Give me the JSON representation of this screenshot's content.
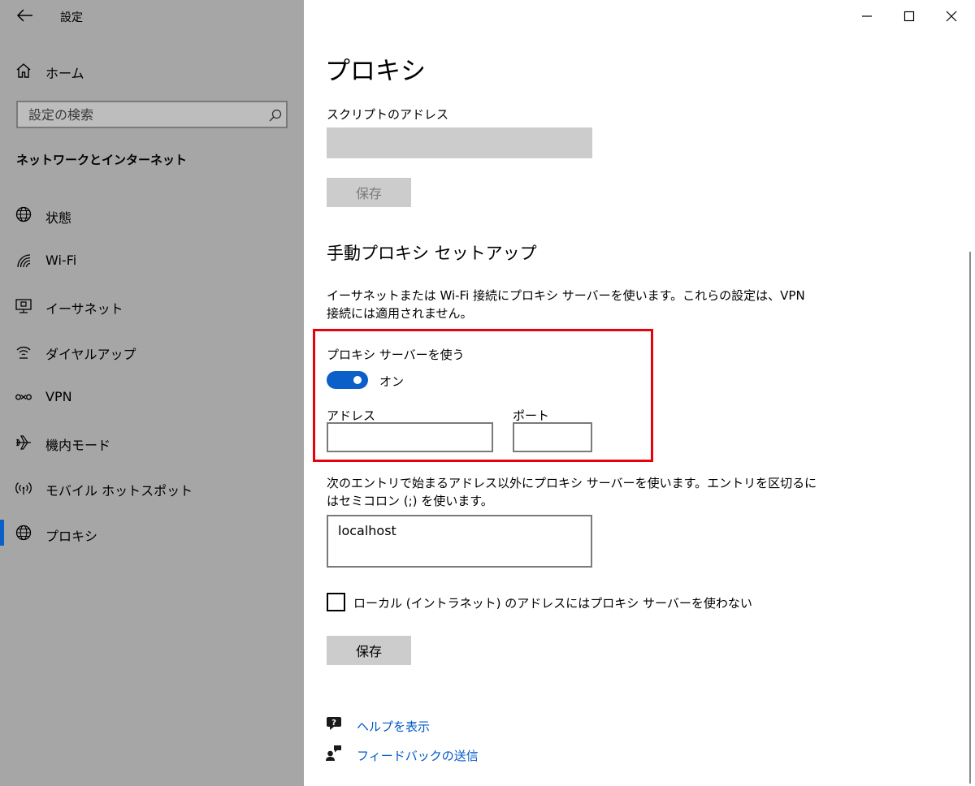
{
  "window": {
    "title": "設定"
  },
  "sidebar": {
    "home_label": "ホーム",
    "search_placeholder": "設定の検索",
    "section_title": "ネットワークとインターネット",
    "items": [
      {
        "label": "状態",
        "icon": "globe-icon"
      },
      {
        "label": "Wi-Fi",
        "icon": "wifi-icon"
      },
      {
        "label": "イーサネット",
        "icon": "ethernet-icon"
      },
      {
        "label": "ダイヤルアップ",
        "icon": "dialup-icon"
      },
      {
        "label": "VPN",
        "icon": "vpn-icon"
      },
      {
        "label": "機内モード",
        "icon": "airplane-icon"
      },
      {
        "label": "モバイル ホットスポット",
        "icon": "hotspot-icon"
      },
      {
        "label": "プロキシ",
        "icon": "globe-icon",
        "selected": true
      }
    ]
  },
  "main": {
    "title": "プロキシ",
    "script_address": {
      "label": "スクリプトのアドレス",
      "value": "",
      "save_label": "保存"
    },
    "manual": {
      "heading": "手動プロキシ セットアップ",
      "description_line1": "イーサネットまたは Wi-Fi 接続にプロキシ サーバーを使います。これらの設定は、VPN",
      "description_line2": "接続には適用されません。",
      "use_proxy_label": "プロキシ サーバーを使う",
      "toggle_state": "オン",
      "toggle_on": true,
      "address_label": "アドレス",
      "address_value": "",
      "port_label": "ポート",
      "port_value": "",
      "exceptions_line1": "次のエントリで始まるアドレス以外にプロキシ サーバーを使います。エントリを区切るに",
      "exceptions_line2": "はセミコロン (;) を使います。",
      "exceptions_value": "localhost",
      "local_bypass_label": "ローカル (イントラネット) のアドレスにはプロキシ サーバーを使わない",
      "local_bypass_checked": false,
      "save_label": "保存"
    },
    "links": {
      "help": "ヘルプを表示",
      "feedback": "フィードバックの送信"
    }
  },
  "colors": {
    "sidebar_bg": "#a6a6a6",
    "accent": "#0a5fc8",
    "highlight_box": "#e8000d",
    "link": "#0058c4"
  }
}
